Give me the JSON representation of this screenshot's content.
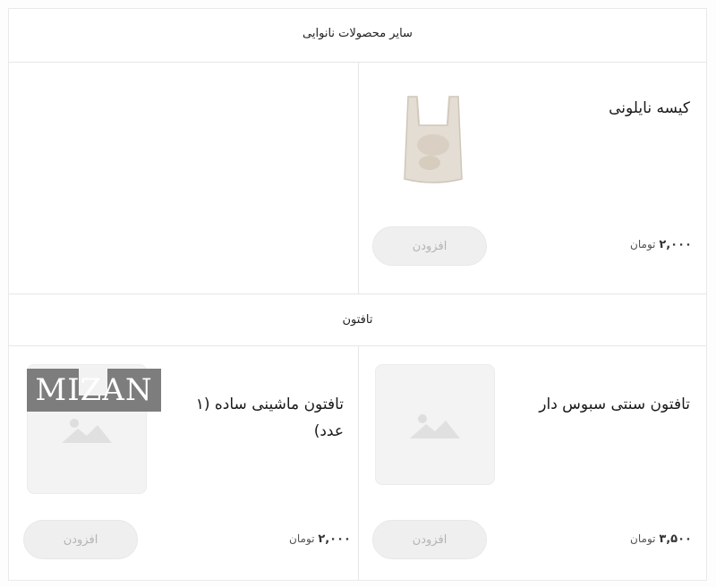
{
  "sections": [
    {
      "header": "سایر محصولات نانوایی",
      "products": [
        {
          "title": "کیسه نایلونی",
          "price": "۲,۰۰۰",
          "currency": "تومان",
          "button": "افزودن",
          "image_icon": "plastic-bag-image"
        }
      ]
    },
    {
      "header": "تافتون",
      "products": [
        {
          "title": "تافتون سنتی سبوس دار",
          "price": "۳,۵۰۰",
          "currency": "تومان",
          "button": "افزودن",
          "image_icon": "image-placeholder-icon"
        },
        {
          "title": "تافتون ماشینی ساده (۱ عدد)",
          "price": "۲,۰۰۰",
          "currency": "تومان",
          "button": "افزودن",
          "image_icon": "image-placeholder-icon"
        }
      ]
    }
  ],
  "watermark": "MIZAN"
}
